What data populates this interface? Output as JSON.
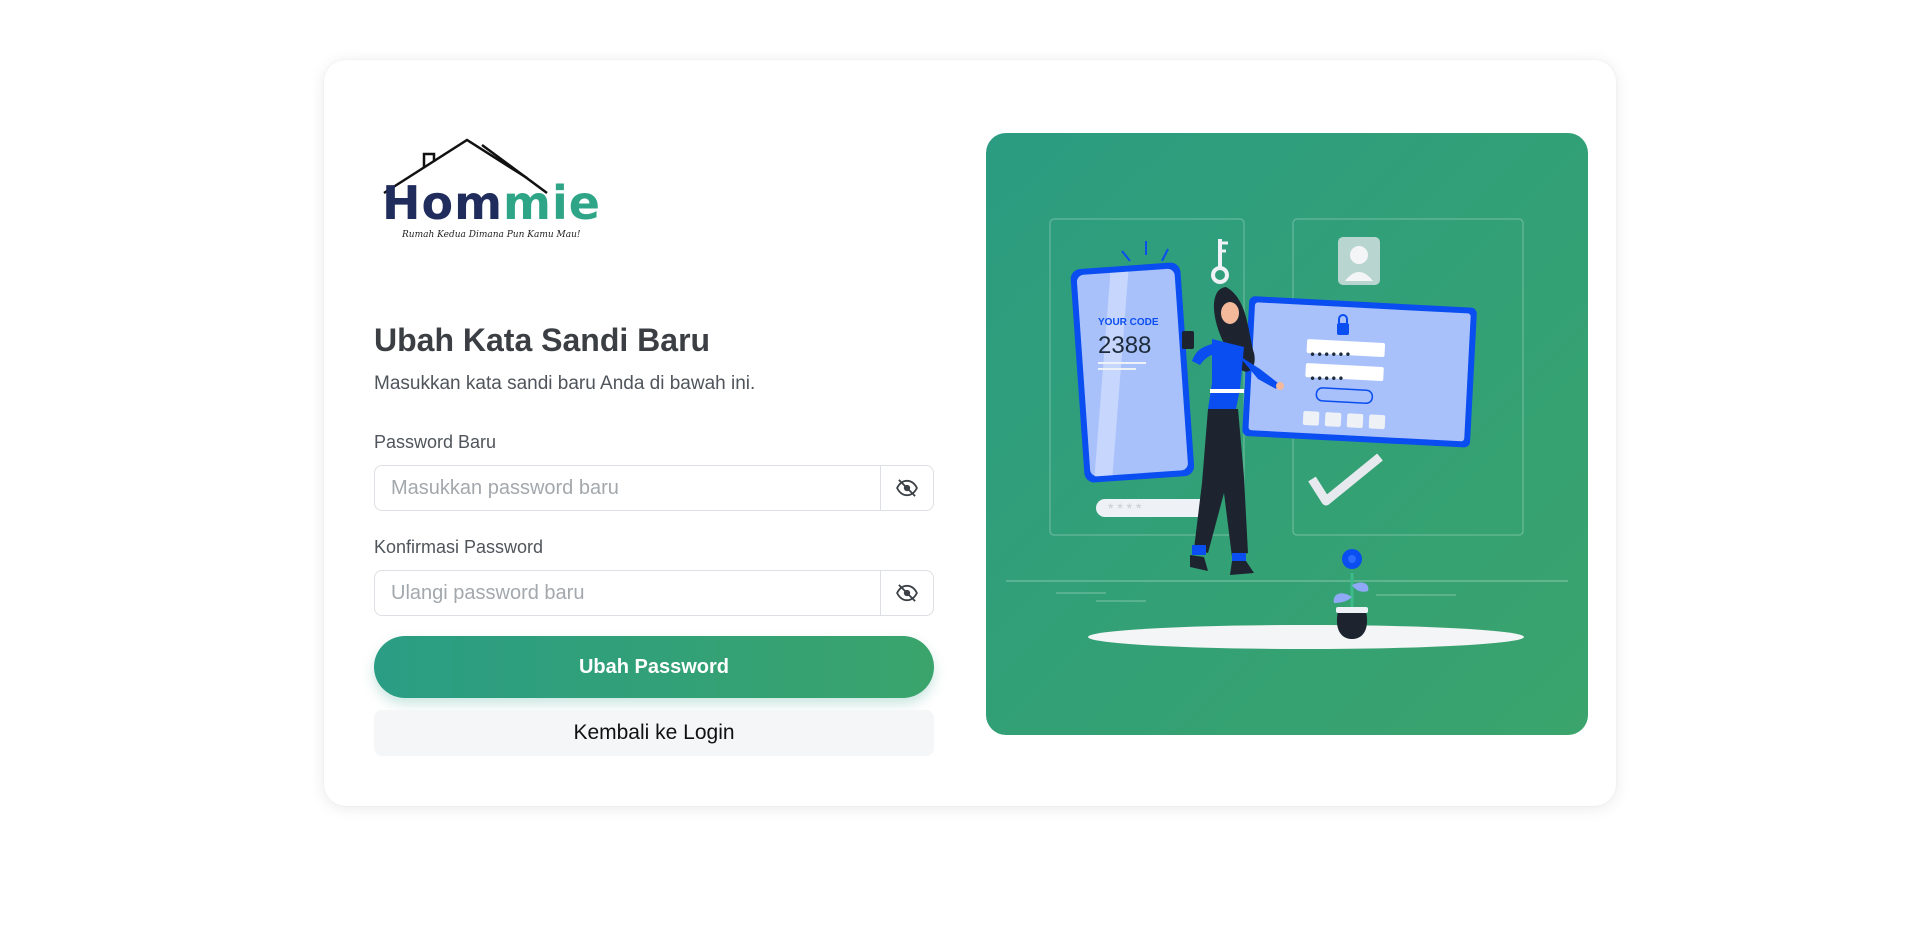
{
  "brand": {
    "name_part1": "Hom",
    "name_part2": "mie",
    "tagline": "Rumah Kedua Dimana Pun Kamu Mau!"
  },
  "form": {
    "title": "Ubah Kata Sandi Baru",
    "subtitle": "Masukkan kata sandi baru Anda di bawah ini.",
    "new_password": {
      "label": "Password Baru",
      "placeholder": "Masukkan password baru",
      "value": ""
    },
    "confirm_password": {
      "label": "Konfirmasi Password",
      "placeholder": "Ulangi password baru",
      "value": ""
    },
    "submit_label": "Ubah Password",
    "back_label": "Kembali ke Login"
  },
  "illustration": {
    "code_caption": "YOUR CODE",
    "code_value": "2388",
    "masked_pw_1": "••••••",
    "masked_pw_2": "•••••",
    "masked_pin": "* * * *"
  },
  "colors": {
    "accent_start": "#2a9d84",
    "accent_end": "#3aa46c",
    "brand_navy": "#1f2c5c",
    "brand_teal": "#2fa588",
    "device_blue": "#0a4df0"
  }
}
